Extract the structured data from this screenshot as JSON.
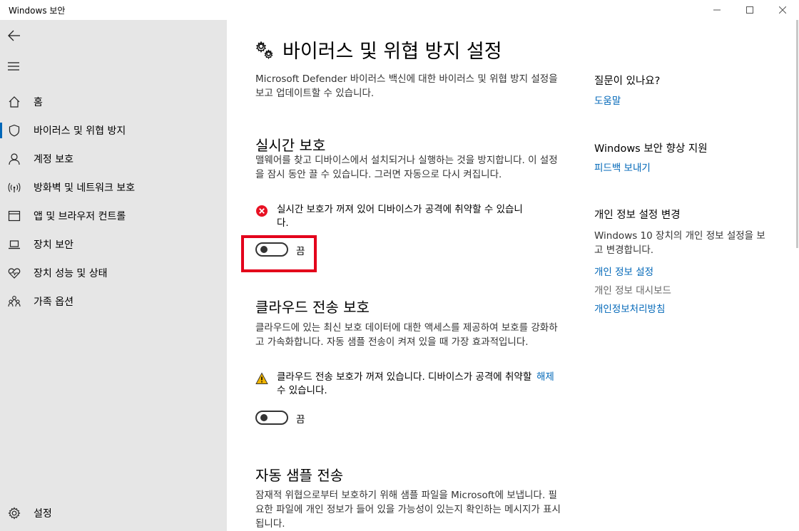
{
  "window": {
    "title": "Windows 보안"
  },
  "sidebar": {
    "items": [
      {
        "label": "홈",
        "icon": "home-icon"
      },
      {
        "label": "바이러스 및 위협 방지",
        "icon": "shield-icon"
      },
      {
        "label": "계정 보호",
        "icon": "person-icon"
      },
      {
        "label": "방화벽 및 네트워크 보호",
        "icon": "wireless-icon"
      },
      {
        "label": "앱 및 브라우저 컨트롤",
        "icon": "app-window-icon"
      },
      {
        "label": "장치 보안",
        "icon": "laptop-icon"
      },
      {
        "label": "장치 성능 및 상태",
        "icon": "heart-pulse-icon"
      },
      {
        "label": "가족 옵션",
        "icon": "family-icon"
      }
    ],
    "settings_label": "설정",
    "active_index": 1
  },
  "main": {
    "title": "바이러스 및 위협 방지 설정",
    "description": "Microsoft Defender 바이러스 백신에 대한 바이러스 및 위협 방지 설정을 보고 업데이트할 수 있습니다.",
    "sections": [
      {
        "title": "실시간 보호",
        "description": "맬웨어를 찾고 디바이스에서 설치되거나 실행하는 것을 방지합니다. 이 설정을 잠시 동안 끌 수 있습니다. 그러면 자동으로 다시 켜집니다.",
        "alert": {
          "type": "error",
          "text": "실시간 보호가 꺼져 있어 디바이스가 공격에 취약할 수 있습니다."
        },
        "toggle_state": "끔",
        "toggle_on": false
      },
      {
        "title": "클라우드 전송 보호",
        "description": "클라우드에 있는 최신 보호 데이터에 대한 액세스를 제공하여 보호를 강화하고 가속화합니다. 자동 샘플 전송이 켜져 있을 때 가장 효과적입니다.",
        "alert": {
          "type": "warning",
          "text": "클라우드 전송 보호가 꺼져 있습니다. 디바이스가 공격에 취약할 수 있습니다.",
          "action": "해제"
        },
        "toggle_state": "끔",
        "toggle_on": false
      },
      {
        "title": "자동 샘플 전송",
        "description": "잠재적 위협으로부터 보호하기 위해 샘플 파일을 Microsoft에 보냅니다. 필요한 파일에 개인 정보가 들어 있을 가능성이 있는지 확인하는 메시지가 표시됩니다."
      }
    ]
  },
  "rail": {
    "question_heading": "질문이 있나요?",
    "help_link": "도움말",
    "improve_heading": "Windows 보안 향상 지원",
    "feedback_link": "피드백 보내기",
    "privacy_heading": "개인 정보 설정 변경",
    "privacy_text": "Windows 10 장치의 개인 정보 설정을 보고 변경합니다.",
    "privacy_settings_link": "개인 정보 설정",
    "privacy_dashboard_link": "개인 정보 대시보드",
    "privacy_statement_link": "개인정보처리방침"
  },
  "colors": {
    "accent": "#0067b8",
    "sidebar_bg": "#e6e6e6",
    "error": "#e81123",
    "warning": "#f0b400",
    "highlight": "#e3001b"
  }
}
